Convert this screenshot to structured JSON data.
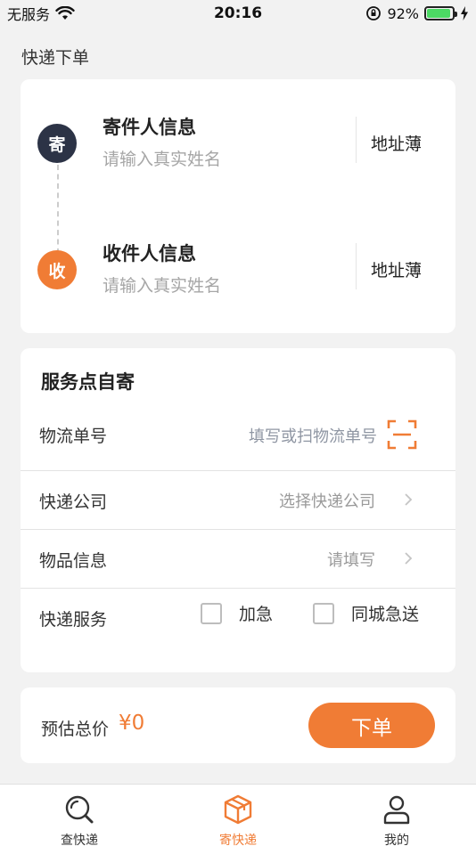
{
  "status_bar": {
    "carrier": "无服务",
    "time": "20:16",
    "battery": "92%",
    "battery_level": 0.92
  },
  "page_title": "快递下单",
  "sender": {
    "badge": "寄",
    "title": "寄件人信息",
    "placeholder": "请输入真实姓名",
    "address_book": "地址薄"
  },
  "receiver": {
    "badge": "收",
    "title": "收件人信息",
    "placeholder": "请输入真实姓名",
    "address_book": "地址薄"
  },
  "service": {
    "title": "服务点自寄",
    "tracking": {
      "label": "物流单号",
      "placeholder": "填写或扫物流单号"
    },
    "company": {
      "label": "快递公司",
      "value": "选择快递公司"
    },
    "goods": {
      "label": "物品信息",
      "value": "请填写"
    },
    "express": {
      "label": "快递服务",
      "options": [
        {
          "label": "加急",
          "checked": false
        },
        {
          "label": "同城急送",
          "checked": false
        }
      ]
    }
  },
  "order": {
    "price_label": "预估总价",
    "price_value": "¥0",
    "button_label": "下单"
  },
  "tabs": [
    {
      "label": "查快递",
      "icon": "search-icon",
      "active": false
    },
    {
      "label": "寄快递",
      "icon": "package-icon",
      "active": true
    },
    {
      "label": "我的",
      "icon": "user-icon",
      "active": false
    }
  ],
  "colors": {
    "accent": "#f07c35",
    "sender_badge": "#2c3346",
    "background": "#f2f2f2"
  }
}
